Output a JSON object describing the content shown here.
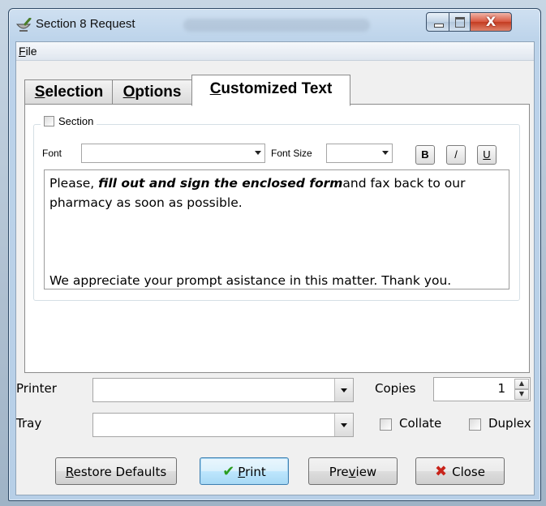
{
  "window": {
    "title": "Section 8 Request",
    "close_glyph": "X"
  },
  "menu": {
    "file_accel": "F",
    "file_rest": "ile"
  },
  "tabs": [
    {
      "accel": "S",
      "rest": "election",
      "selected": false
    },
    {
      "accel": "O",
      "rest": "ptions",
      "selected": false
    },
    {
      "accel": "C",
      "rest": "ustomized Text",
      "selected": true
    }
  ],
  "section": {
    "checkbox_label": "Section",
    "checked": false,
    "font_label": "Font",
    "font_value": "",
    "font_size_label": "Font Size",
    "font_size_value": "",
    "bold_label": "B",
    "italic_label": "/",
    "underline_label": "U",
    "text": {
      "l1_a": "Please, ",
      "l1_bold": "fill out and sign the enclosed form",
      "l1_b": "and fax back to our",
      "l2": "pharmacy as soon as possible.",
      "l3": "We appreciate your prompt asistance in this matter.  Thank you."
    }
  },
  "printer": {
    "label": "Printer",
    "value": ""
  },
  "tray": {
    "label": "Tray",
    "value": ""
  },
  "copies": {
    "label": "Copies",
    "value": "1"
  },
  "collate": {
    "label": "Collate",
    "checked": false
  },
  "duplex": {
    "label": "Duplex",
    "checked": false
  },
  "buttons": {
    "restore": {
      "accel": "R",
      "rest": "estore Defaults"
    },
    "print": {
      "accel": "P",
      "rest": "rint",
      "glyph": "✔"
    },
    "preview": {
      "pre": "Pre",
      "accel": "v",
      "rest": "iew"
    },
    "close": {
      "label": "Close",
      "glyph": "✖"
    }
  },
  "colors": {
    "accent": "#3c7fb1",
    "check_green": "#2a9d1f",
    "close_red": "#c8231a"
  }
}
